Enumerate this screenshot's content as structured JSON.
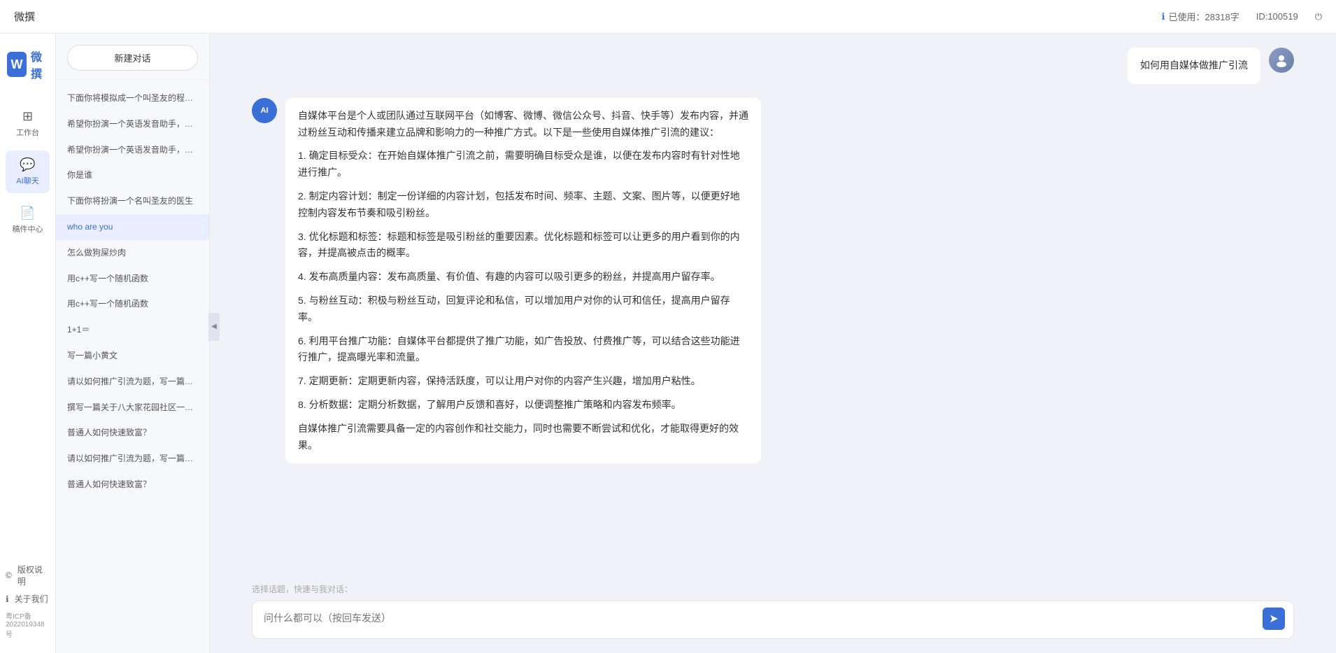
{
  "topbar": {
    "title": "微撰",
    "usage_label": "已使用：28318字",
    "usage_icon": "info-icon",
    "id_label": "ID:100519",
    "logout_icon": "power-icon"
  },
  "logo": {
    "w_letter": "W",
    "brand_name": "微撰"
  },
  "nav": {
    "items": [
      {
        "id": "workbench",
        "icon": "⊞",
        "label": "工作台"
      },
      {
        "id": "ai-chat",
        "icon": "💬",
        "label": "AI聊天",
        "active": true
      },
      {
        "id": "drafts",
        "icon": "📄",
        "label": "稿件中心"
      }
    ],
    "footer_items": [
      {
        "id": "copyright",
        "icon": "©",
        "label": "版权说明"
      },
      {
        "id": "about",
        "icon": "ℹ",
        "label": "关于我们"
      }
    ],
    "icp": "粤ICP备2022019348号"
  },
  "sidebar": {
    "new_chat_label": "新建对话",
    "chat_items": [
      {
        "id": 1,
        "text": "下面你将模拟成一个叫圣友的程序员、我说...",
        "active": false
      },
      {
        "id": 2,
        "text": "希望你扮演一个英语发音助手，我提供给你...",
        "active": false
      },
      {
        "id": 3,
        "text": "希望你扮演一个英语发音助手，我提供给你...",
        "active": false
      },
      {
        "id": 4,
        "text": "你是谁",
        "active": false
      },
      {
        "id": 5,
        "text": "下面你将扮演一个名叫圣友的医生",
        "active": false
      },
      {
        "id": 6,
        "text": "who are you",
        "active": true
      },
      {
        "id": 7,
        "text": "怎么做狗屎炒肉",
        "active": false
      },
      {
        "id": 8,
        "text": "用c++写一个随机函数",
        "active": false
      },
      {
        "id": 9,
        "text": "用c++写一个随机函数",
        "active": false
      },
      {
        "id": 10,
        "text": "1+1＝",
        "active": false
      },
      {
        "id": 11,
        "text": "写一篇小黄文",
        "active": false
      },
      {
        "id": 12,
        "text": "请以如何推广引流为题，写一篇大纲",
        "active": false
      },
      {
        "id": 13,
        "text": "撰写一篇关于八大家花园社区一刻钟便民生...",
        "active": false
      },
      {
        "id": 14,
        "text": "普通人如何快速致富？",
        "active": false
      },
      {
        "id": 15,
        "text": "请以如何推广引流为题，写一篇大纲",
        "active": false
      },
      {
        "id": 16,
        "text": "普通人如何快速致富？",
        "active": false
      }
    ]
  },
  "chat": {
    "messages": [
      {
        "id": 1,
        "role": "user",
        "text": "如何用自媒体做推广引流"
      },
      {
        "id": 2,
        "role": "ai",
        "text": "自媒体平台是个人或团队通过互联网平台（如博客、微博、微信公众号、抖音、快手等）发布内容，并通过粉丝互动和传播来建立品牌和影响力的一种推广方式。以下是一些使用自媒体推广引流的建议：\n\n1. 确定目标受众：在开始自媒体推广引流之前，需要明确目标受众是谁，以便在发布内容时有针对性地进行推广。\n\n2. 制定内容计划：制定一份详细的内容计划，包括发布时间、频率、主题、文案、图片等，以便更好地控制内容发布节奏和吸引粉丝。\n\n3. 优化标题和标签：标题和标签是吸引粉丝的重要因素。优化标题和标签可以让更多的用户看到你的内容，并提高被点击的概率。\n\n4. 发布高质量内容：发布高质量、有价值、有趣的内容可以吸引更多的粉丝，并提高用户留存率。\n\n5. 与粉丝互动：积极与粉丝互动，回复评论和私信，可以增加用户对你的认可和信任，提高用户留存率。\n\n6. 利用平台推广功能：自媒体平台都提供了推广功能，如广告投放、付费推广等，可以结合这些功能进行推广，提高曝光率和流量。\n\n7. 定期更新：定期更新内容，保持活跃度，可以让用户对你的内容产生兴趣，增加用户粘性。\n\n8. 分析数据：定期分析数据，了解用户反馈和喜好，以便调整推广策略和内容发布频率。\n\n自媒体推广引流需要具备一定的内容创作和社交能力，同时也需要不断尝试和优化，才能取得更好的效果。"
      }
    ],
    "input_placeholder": "问什么都可以（按回车发送）",
    "quick_topic_label": "选择话题，快速与我对话：",
    "send_icon": "➤"
  }
}
